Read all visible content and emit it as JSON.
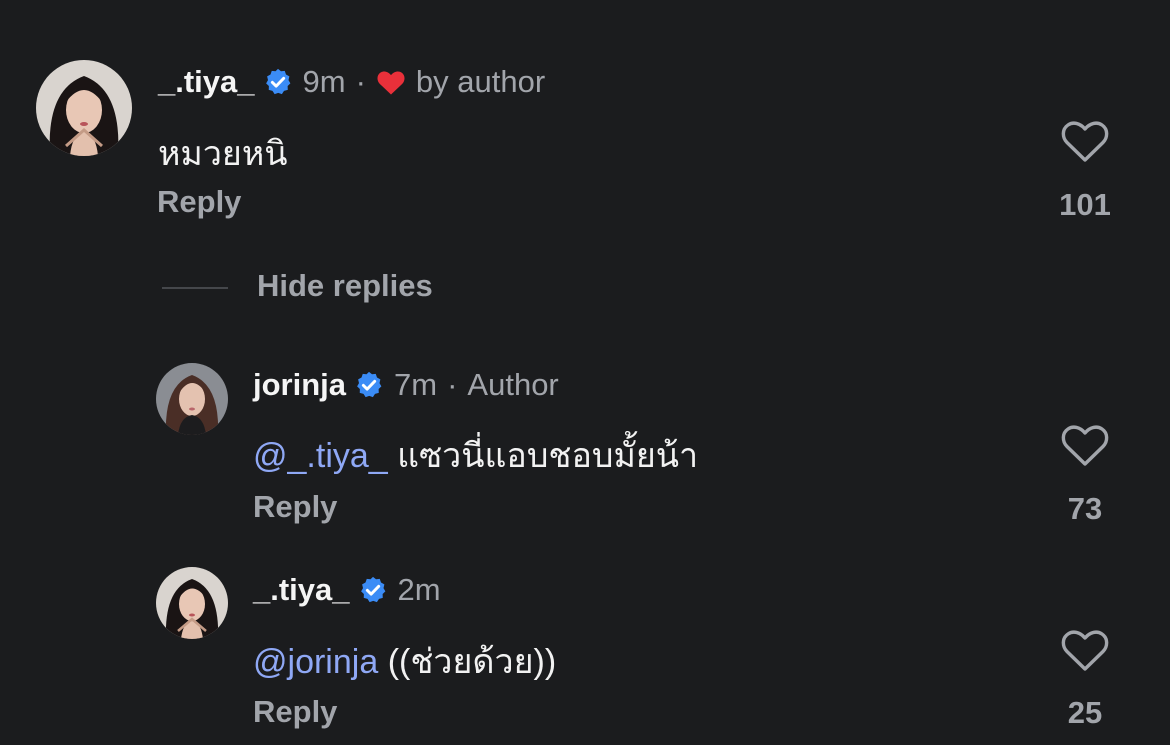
{
  "colors": {
    "background": "#1b1c1e",
    "text_primary": "#f2f2f2",
    "text_secondary": "#a2a5ab",
    "mention": "#8fa8f5",
    "verified": "#3b8cf6",
    "author_heart": "#e9303a"
  },
  "comments": [
    {
      "username": "_.tiya_",
      "verified": true,
      "time": "9m",
      "liked_by_author_label": "by author",
      "text": "หมวยหนิ",
      "reply_label": "Reply",
      "likes": "101",
      "avatar_icon": "avatar-photo"
    }
  ],
  "thread": {
    "hide_replies_label": "Hide replies"
  },
  "replies": [
    {
      "username": "jorinja",
      "verified": true,
      "time": "7m",
      "author_tag": "Author",
      "mention": "@_.tiya_",
      "text": "แซวนี่แอบชอบมั้ยน้า",
      "reply_label": "Reply",
      "likes": "73",
      "avatar_icon": "avatar-photo"
    },
    {
      "username": "_.tiya_",
      "verified": true,
      "time": "2m",
      "mention": "@jorinja",
      "text": "((ช่วยด้วย))",
      "reply_label": "Reply",
      "likes": "25",
      "avatar_icon": "avatar-photo"
    }
  ]
}
